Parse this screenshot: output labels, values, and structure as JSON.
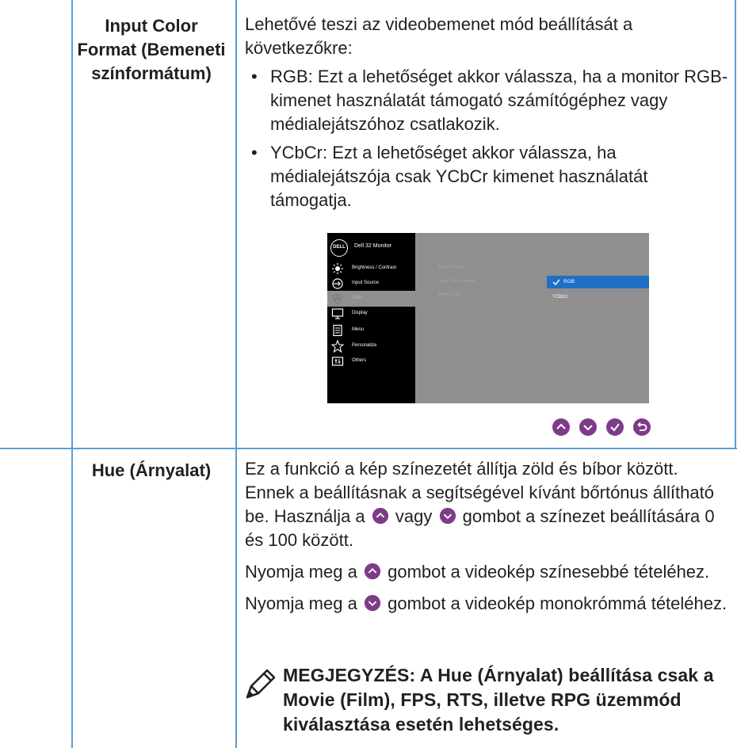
{
  "input_color_format": {
    "label": "Input Color Format (Bemeneti színformátum)",
    "intro": "Lehetővé teszi az videobemenet mód beállítását a következőkre:",
    "bullets": [
      {
        "term": "RGB",
        "text": ": Ezt a lehetőséget akkor válassza, ha a monitor RGB-kimenet használatát támogató számítógéphez vagy médialejátszóhoz csatlakozik."
      },
      {
        "term": "YCbCr",
        "text": ": Ezt a lehetőséget akkor válassza, ha médialejátszója csak YCbCr kimenet használatát támogatja."
      }
    ]
  },
  "osd": {
    "logo": "DELL",
    "title": "Dell 32 Monitor",
    "menu": [
      {
        "label": "Brightness / Contrast",
        "icon": "brightness-icon"
      },
      {
        "label": "Input Source",
        "icon": "input-source-icon"
      },
      {
        "label": "Color",
        "icon": "color-icon"
      },
      {
        "label": "Display",
        "icon": "display-icon"
      },
      {
        "label": "Menu",
        "icon": "menu-icon"
      },
      {
        "label": "Personalize",
        "icon": "star-icon"
      },
      {
        "label": "Others",
        "icon": "others-icon"
      }
    ],
    "submenu": [
      "Preset Modes",
      "Input Color Format",
      "Reset Color"
    ],
    "options": [
      "RGB",
      "YCbCr"
    ],
    "selected_option": "RGB",
    "colors": {
      "highlight": "#1f6fc4",
      "panel": "#8f8f8f",
      "menu_bg": "#000000"
    }
  },
  "nav_buttons": [
    "up-icon",
    "down-icon",
    "confirm-icon",
    "back-icon"
  ],
  "hue": {
    "label": "Hue (Árnyalat)",
    "p1_a": "Ez a funkció a kép színezetét állítja zöld és bíbor között. Ennek a beállításnak a segítségével kívánt bőrtónus állítható be. Használja a",
    "p1_b": "vagy",
    "p1_c": "gombot a színezet beállítására 0 és 100 között.",
    "p2_a": "Nyomja meg a",
    "p2_b": "gombot a videokép színesebbé tételéhez.",
    "p3_a": "Nyomja meg a",
    "p3_b": "gombot a videokép monokrómmá tételéhez.",
    "note": "MEGJEGYZÉS: A Hue (Árnyalat) beállítása csak a Movie (Film), FPS, RTS, illetve RPG üzemmód kiválasztása esetén lehetséges."
  },
  "grid_color": "#5c9ed6",
  "button_color": "#7e3b8a"
}
